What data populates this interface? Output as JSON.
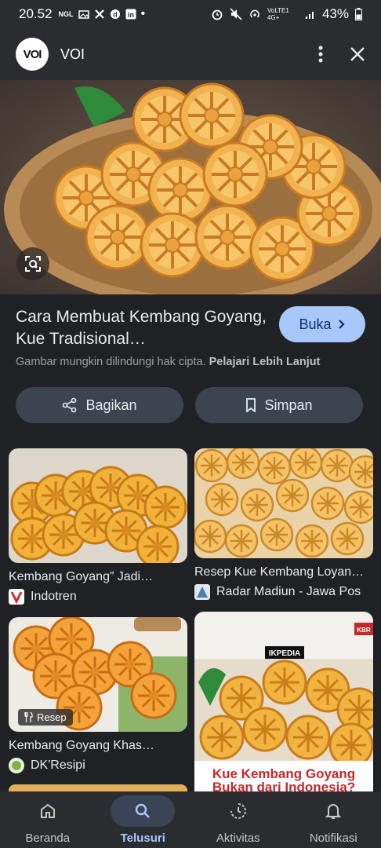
{
  "status_bar": {
    "time": "20.52",
    "notif_icons": [
      "NGL",
      "photo-icon",
      "x-icon",
      "d-icon",
      "in-icon",
      "•"
    ],
    "signal_text": "VoLTE1 4G+",
    "battery": "43%"
  },
  "header": {
    "logo_text": "VOI",
    "site_name": "VOI"
  },
  "result": {
    "title": "Cara Membuat Kembang Goyang, Kue Tradisional…",
    "open_label": "Buka",
    "copyright_text": "Gambar mungkin dilindungi hak cipta.",
    "learn_more": "Pelajari Lebih Lanjut",
    "share_label": "Bagikan",
    "save_label": "Simpan"
  },
  "related": [
    {
      "title": "Kembang Goyang” Jadi…",
      "source": "Indotren",
      "fav_color": "#ffffff"
    },
    {
      "title": "Resep Kue Kembang Loyan…",
      "source": "Radar Madiun - Jawa Pos",
      "fav_color": "#4a7fb5"
    },
    {
      "title": "Kembang Goyang Khas…",
      "source": "DK'Resipi",
      "badge": "Resep",
      "fav_color": "#7cb342"
    },
    {
      "title": "",
      "source": "",
      "overlay_brand": "IKPEDIA",
      "overlay_corner": "KBR",
      "overlay_caption": "Kue Kembang Goyang Bukan dari Indonesia?"
    }
  ],
  "nav": [
    {
      "label": "Beranda",
      "icon": "home-icon",
      "active": false
    },
    {
      "label": "Telusuri",
      "icon": "search-icon",
      "active": true
    },
    {
      "label": "Aktivitas",
      "icon": "activity-icon",
      "active": false
    },
    {
      "label": "Notifikasi",
      "icon": "bell-icon",
      "active": false
    }
  ],
  "colors": {
    "accent": "#a8c7fa",
    "background": "#202124",
    "button": "#3c4452"
  }
}
